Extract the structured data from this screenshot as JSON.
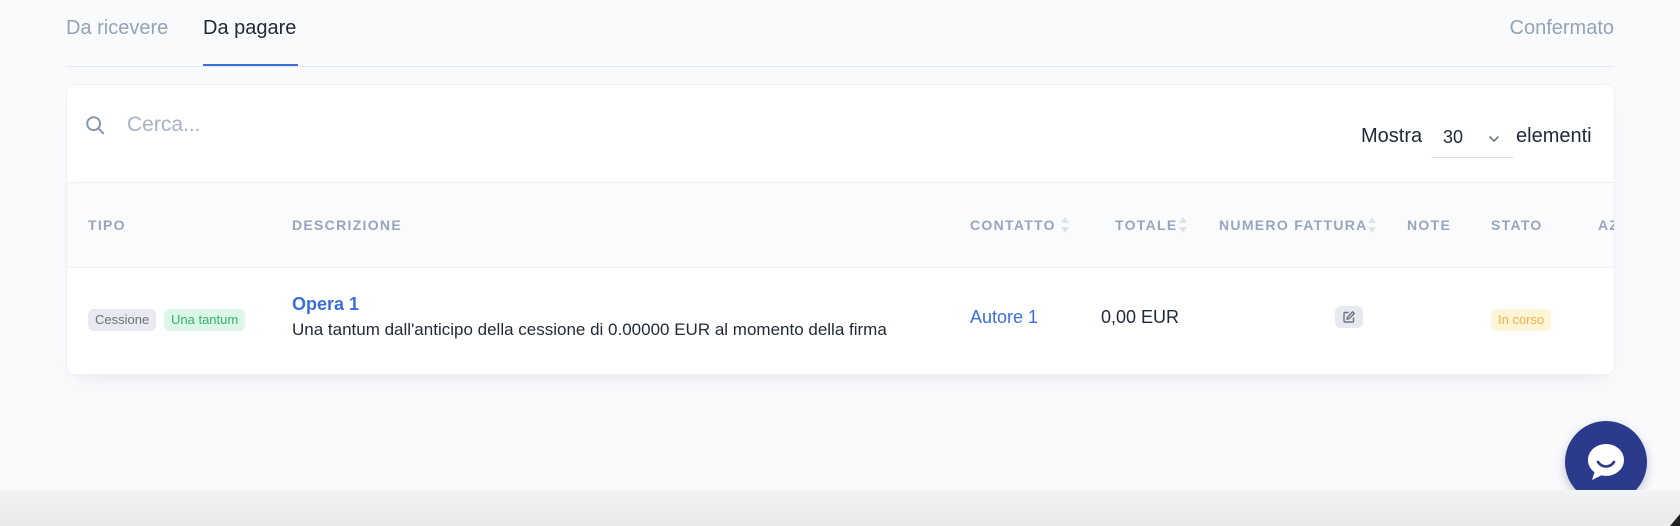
{
  "tabs": [
    {
      "label": "Da ricevere",
      "active": false
    },
    {
      "label": "Da pagare",
      "active": true
    }
  ],
  "status_tab": {
    "label": "Confermato"
  },
  "search": {
    "placeholder": "Cerca..."
  },
  "page_size": {
    "prefix": "Mostra",
    "value": "30",
    "suffix": "elementi"
  },
  "table": {
    "columns": [
      {
        "label": "TIPO",
        "sortable": false
      },
      {
        "label": "DESCRIZIONE",
        "sortable": false
      },
      {
        "label": "CONTATTO",
        "sortable": true
      },
      {
        "label": "TOTALE",
        "sortable": true
      },
      {
        "label": "NUMERO FATTURA",
        "sortable": true
      },
      {
        "label": "NOTE",
        "sortable": false
      },
      {
        "label": "STATO",
        "sortable": false
      },
      {
        "label": "AZ",
        "sortable": false
      }
    ],
    "rows": [
      {
        "badges": [
          "Cessione",
          "Una tantum"
        ],
        "title": "Opera 1",
        "description": "Una tantum dall'anticipo della cessione di 0.00000 EUR al momento della firma",
        "contact": "Autore 1",
        "total": "0,00 EUR",
        "invoice_icon": "edit-icon",
        "note": "",
        "status": "In corso"
      }
    ]
  },
  "colors": {
    "accent": "#3b6fd8",
    "chat": "#2b3a8a",
    "status_pending": "#f0b44a",
    "badge_green": "#34b36b"
  },
  "icons": {
    "search": "search-icon",
    "chevron": "chevron-down-icon",
    "sort": "sort-icon",
    "chat": "chat-bubble-icon"
  }
}
